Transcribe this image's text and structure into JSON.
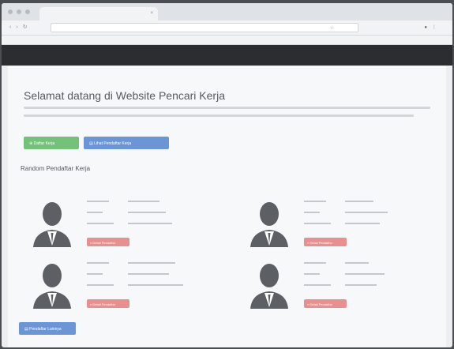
{
  "site": {
    "heading": "Selamat datang di Website Pencari Kerja",
    "random_heading": "Random Pendaftar Kerja",
    "buttons": {
      "primary_green": "Daftar Kerja",
      "primary_blue": "Lihat Pendaftar Kerja",
      "bottom_blue": "Pendaftar Lainnya",
      "card_red": "Detail Pendaftar"
    },
    "cards": [
      {
        "id": "1"
      },
      {
        "id": "2"
      },
      {
        "id": "3"
      },
      {
        "id": "4"
      }
    ]
  },
  "colors": {
    "green": "#74c179",
    "blue": "#6b95d4",
    "red": "#e88f8f",
    "navbar": "#2b2d31"
  }
}
